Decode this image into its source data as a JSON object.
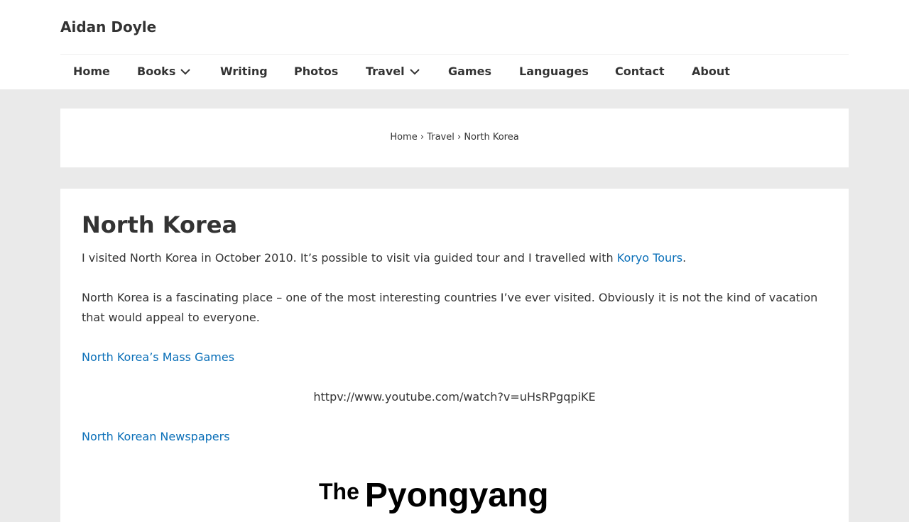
{
  "site": {
    "title": "Aidan Doyle"
  },
  "nav": [
    {
      "label": "Home"
    },
    {
      "label": "Books",
      "dropdown": true
    },
    {
      "label": "Writing"
    },
    {
      "label": "Photos"
    },
    {
      "label": "Travel",
      "dropdown": true
    },
    {
      "label": "Games"
    },
    {
      "label": "Languages"
    },
    {
      "label": "Contact"
    },
    {
      "label": "About"
    }
  ],
  "breadcrumb": {
    "home": "Home",
    "sep1": "›",
    "travel": "Travel",
    "sep2": "›",
    "current": "North Korea"
  },
  "page": {
    "title": "North Korea",
    "p1_text": "I visited North Korea in October 2010.  It’s possible to visit via guided tour and I travelled with ",
    "p1_link": "Koryo Tours",
    "p1_end": ".",
    "p2_line1": "North Korea is a fascinating place – one of the most interesting countries I’ve ever visited.  Obviously it is not the kind of vacation",
    "p2_line2": "that would appeal to everyone.",
    "mass_games_link": "North Korea’s Mass Games",
    "youtube_url": "httpv://www.youtube.com/watch?v=uHsRPgqpiKE",
    "newspapers_link": "North Korean Newspapers",
    "newspaper_masthead": "The Pyongyang"
  },
  "colors": {
    "link": "#0a6fb8",
    "text": "#333333",
    "background": "#eaeaea"
  }
}
